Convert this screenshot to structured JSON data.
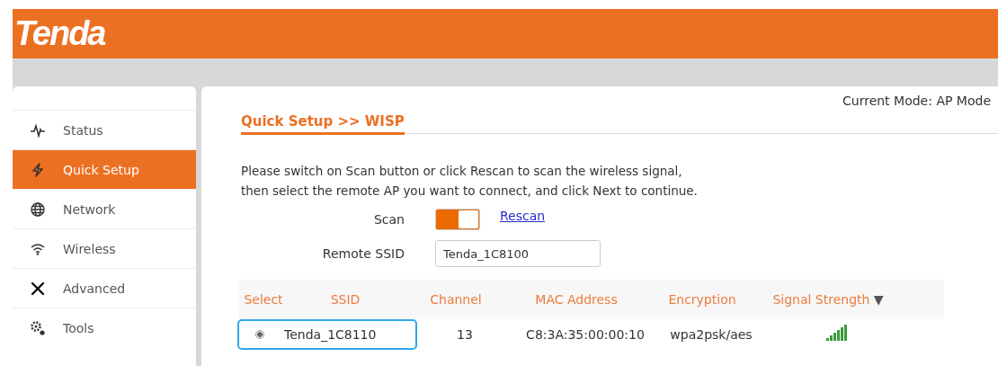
{
  "header": {
    "logo": "Tenda"
  },
  "sidebar": {
    "items": [
      {
        "label": "Status",
        "selected": false
      },
      {
        "label": "Quick Setup",
        "selected": true
      },
      {
        "label": "Network",
        "selected": false
      },
      {
        "label": "Wireless",
        "selected": false
      },
      {
        "label": "Advanced",
        "selected": false
      },
      {
        "label": "Tools",
        "selected": false
      }
    ]
  },
  "main": {
    "mode": "Current Mode: AP Mode",
    "breadcrumb": "Quick Setup >>  WISP",
    "instructions": [
      "Please switch on Scan button or click Rescan to scan the wireless signal,",
      "then select the remote AP you want to connect, and click Next to continue."
    ],
    "scan": {
      "label": "Scan",
      "on": true,
      "rescan": "Rescan"
    },
    "remote_ssid": {
      "label": "Remote SSID",
      "value": "Tenda_1C8100"
    },
    "table": {
      "columns": [
        "Select",
        "SSID",
        "Channel",
        "MAC Address",
        "Encryption",
        "Signal Strength"
      ],
      "sort_indicator": "▼",
      "rows": [
        {
          "selected": true,
          "ssid": "Tenda_1C8110",
          "channel": "13",
          "mac": "C8:3A:35:00:00:10",
          "encryption": "wpa2psk/aes"
        }
      ]
    }
  }
}
